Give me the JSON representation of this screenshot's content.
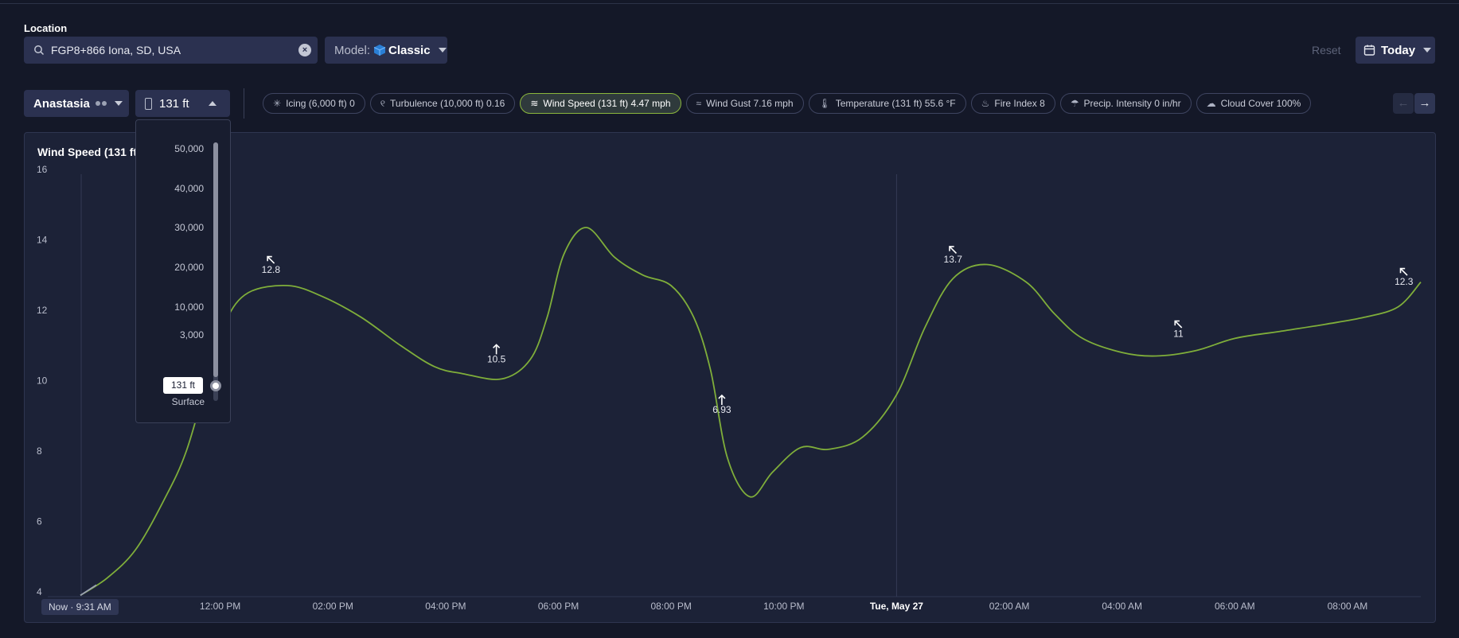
{
  "location": {
    "label": "Location",
    "value": "FGP8+866 Iona, SD, USA",
    "icon": "search-icon"
  },
  "model": {
    "label": "Model:",
    "value": "Classic"
  },
  "header": {
    "reset_label": "Reset",
    "date_label": "Today"
  },
  "account": {
    "name": "Anastasia"
  },
  "altitude": {
    "selected": "131 ft",
    "levels": [
      "50,000",
      "40,000",
      "30,000",
      "20,000",
      "10,000",
      "3,000"
    ],
    "current_badge": "131 ft",
    "surface_label": "Surface"
  },
  "chips": [
    {
      "icon": "snowflake-icon",
      "glyph": "✳",
      "label": "Icing (6,000 ft) 0",
      "active": false
    },
    {
      "icon": "turbulence-icon",
      "glyph": "୧",
      "label": "Turbulence (10,000 ft) 0.16",
      "active": false
    },
    {
      "icon": "wind-icon",
      "glyph": "≋",
      "label": "Wind Speed (131 ft) 4.47 mph",
      "active": true
    },
    {
      "icon": "wind-gust-icon",
      "glyph": "≈",
      "label": "Wind Gust 7.16 mph",
      "active": false
    },
    {
      "icon": "thermometer-icon",
      "glyph": "🌡",
      "label": "Temperature (131 ft) 55.6 °F",
      "active": false
    },
    {
      "icon": "fire-icon",
      "glyph": "♨",
      "label": "Fire Index 8",
      "active": false
    },
    {
      "icon": "precip-icon",
      "glyph": "☂",
      "label": "Precip. Intensity 0 in/hr",
      "active": false
    },
    {
      "icon": "cloud-icon",
      "glyph": "☁",
      "label": "Cloud Cover 100%",
      "active": false
    }
  ],
  "chart": {
    "title": "Wind Speed (131 ft)",
    "now_label": "Now · 9:31 AM",
    "line_color": "#7fae3a"
  },
  "chart_data": {
    "type": "line",
    "title": "Wind Speed (131 ft)",
    "ylim": [
      4,
      16
    ],
    "yticks": [
      4,
      6,
      8,
      10,
      12,
      14,
      16
    ],
    "xlim_hours": [
      9.52,
      33.3
    ],
    "xticks": [
      {
        "t": 12,
        "label": "12:00 PM",
        "bold": false
      },
      {
        "t": 14,
        "label": "02:00 PM",
        "bold": false
      },
      {
        "t": 16,
        "label": "04:00 PM",
        "bold": false
      },
      {
        "t": 18,
        "label": "06:00 PM",
        "bold": false
      },
      {
        "t": 20,
        "label": "08:00 PM",
        "bold": false
      },
      {
        "t": 22,
        "label": "10:00 PM",
        "bold": false
      },
      {
        "t": 24,
        "label": "Tue, May 27",
        "bold": true
      },
      {
        "t": 26,
        "label": "02:00 AM",
        "bold": false
      },
      {
        "t": 28,
        "label": "04:00 AM",
        "bold": false
      },
      {
        "t": 30,
        "label": "06:00 AM",
        "bold": false
      },
      {
        "t": 32,
        "label": "08:00 AM",
        "bold": false
      }
    ],
    "series": [
      {
        "values": [
          [
            9.52,
            3.9
          ],
          [
            10.0,
            4.4
          ],
          [
            10.5,
            5.2
          ],
          [
            11.0,
            6.6
          ],
          [
            11.4,
            8.0
          ],
          [
            11.8,
            10.2
          ],
          [
            12.1,
            11.7
          ],
          [
            12.5,
            12.5
          ],
          [
            13.2,
            12.7
          ],
          [
            13.8,
            12.4
          ],
          [
            14.5,
            11.8
          ],
          [
            15.2,
            11.0
          ],
          [
            15.8,
            10.4
          ],
          [
            16.3,
            10.2
          ],
          [
            17.0,
            10.05
          ],
          [
            17.5,
            10.6
          ],
          [
            17.8,
            11.8
          ],
          [
            18.1,
            13.6
          ],
          [
            18.5,
            14.35
          ],
          [
            19.0,
            13.5
          ],
          [
            19.5,
            13.0
          ],
          [
            20.0,
            12.7
          ],
          [
            20.4,
            11.8
          ],
          [
            20.7,
            10.3
          ],
          [
            21.0,
            7.8
          ],
          [
            21.4,
            6.7
          ],
          [
            21.8,
            7.4
          ],
          [
            22.3,
            8.1
          ],
          [
            22.8,
            8.05
          ],
          [
            23.4,
            8.4
          ],
          [
            24.0,
            9.6
          ],
          [
            24.5,
            11.5
          ],
          [
            25.0,
            12.9
          ],
          [
            25.6,
            13.3
          ],
          [
            26.3,
            12.8
          ],
          [
            26.8,
            11.9
          ],
          [
            27.3,
            11.2
          ],
          [
            28.0,
            10.8
          ],
          [
            28.6,
            10.7
          ],
          [
            29.3,
            10.85
          ],
          [
            30.0,
            11.2
          ],
          [
            30.8,
            11.4
          ],
          [
            31.6,
            11.6
          ],
          [
            32.3,
            11.8
          ],
          [
            32.9,
            12.1
          ],
          [
            33.3,
            12.8
          ]
        ]
      }
    ],
    "annotations": [
      {
        "t": 12.9,
        "label": "12.8",
        "arrow": "nw"
      },
      {
        "t": 16.9,
        "label": "10.5",
        "arrow": "n"
      },
      {
        "t": 20.9,
        "label": "6.93",
        "arrow": "n"
      },
      {
        "t": 25.0,
        "label": "13.7",
        "arrow": "nw"
      },
      {
        "t": 29.0,
        "label": "11",
        "arrow": "nw"
      },
      {
        "t": 33.0,
        "label": "12.3",
        "arrow": "nw"
      }
    ]
  }
}
